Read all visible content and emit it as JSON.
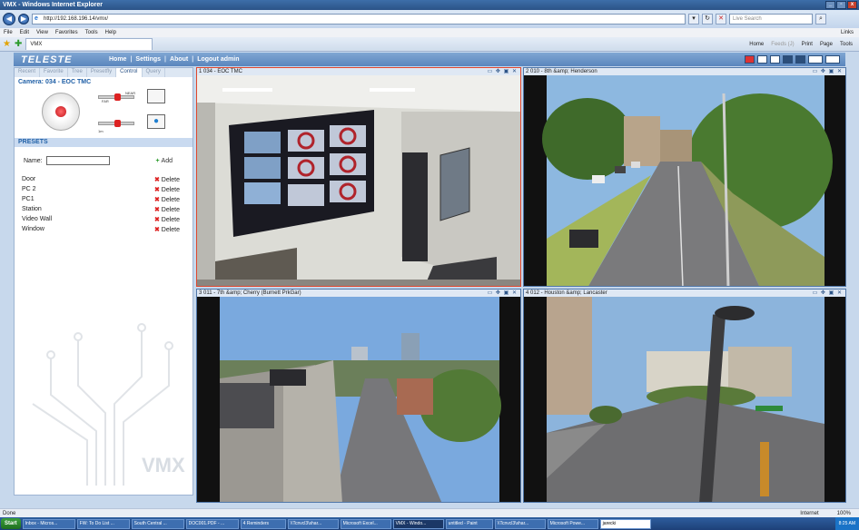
{
  "browser": {
    "title": "VMX - Windows Internet Explorer",
    "url": "http://192.168.196.14/vmx/",
    "search_placeholder": "Live Search",
    "menus": [
      "File",
      "Edit",
      "View",
      "Favorites",
      "Tools",
      "Help"
    ],
    "links_label": "Links",
    "tab_label": "VMX",
    "commands": [
      "Home",
      "Feeds (J)",
      "Print",
      "Page",
      "Tools"
    ],
    "status_left": "Done",
    "zone": "Internet",
    "zoom": "100%"
  },
  "app": {
    "logo": "TELESTE",
    "nav": [
      "Home",
      "Settings",
      "About",
      "Logout admin"
    ],
    "nav_sep": "|"
  },
  "left": {
    "tabs": [
      "Recent",
      "Favorite",
      "Tree",
      "Presetfly",
      "Control",
      "Query"
    ],
    "active_tab": "Control",
    "camera_title": "Camera: 034 - EOC TMC",
    "zoom_near": "NEAR",
    "zoom_far": "FAR",
    "focus_label": "1m",
    "presets_header": "PRESETS",
    "name_label": "Name:",
    "name_value": "",
    "add_label": "Add",
    "delete_label": "Delete",
    "presets": [
      "Door",
      "PC 2",
      "PC1",
      "Station",
      "Video Wall",
      "Window"
    ],
    "watermark": "VMX"
  },
  "tiles": [
    {
      "title": "1 034 - EOC TMC"
    },
    {
      "title": "2 010 - 8th &amp; Henderson"
    },
    {
      "title": "3 011 - 7th &amp; Cherry (Burnett PrkGar)"
    },
    {
      "title": "4 012 - Houston &amp; Lancaster"
    }
  ],
  "tile_controls": "▭ ✥ ▣ ✕",
  "taskbar": {
    "start": "Start",
    "items": [
      "Inbox - Micros...",
      "FW: To Do List ...",
      "South Central ...",
      "DOC001.PDF - ...",
      "4 Reminders",
      "\\\\Tcnvcl3\\shar...",
      "Microsoft Excel...",
      "VMX - Windo...",
      "untitled - Paint",
      "\\\\Tcnvcl3\\shar...",
      "Microsoft Powe..."
    ],
    "active_index": 7,
    "search_value": "jarecki",
    "clock": "8:25 AM"
  }
}
